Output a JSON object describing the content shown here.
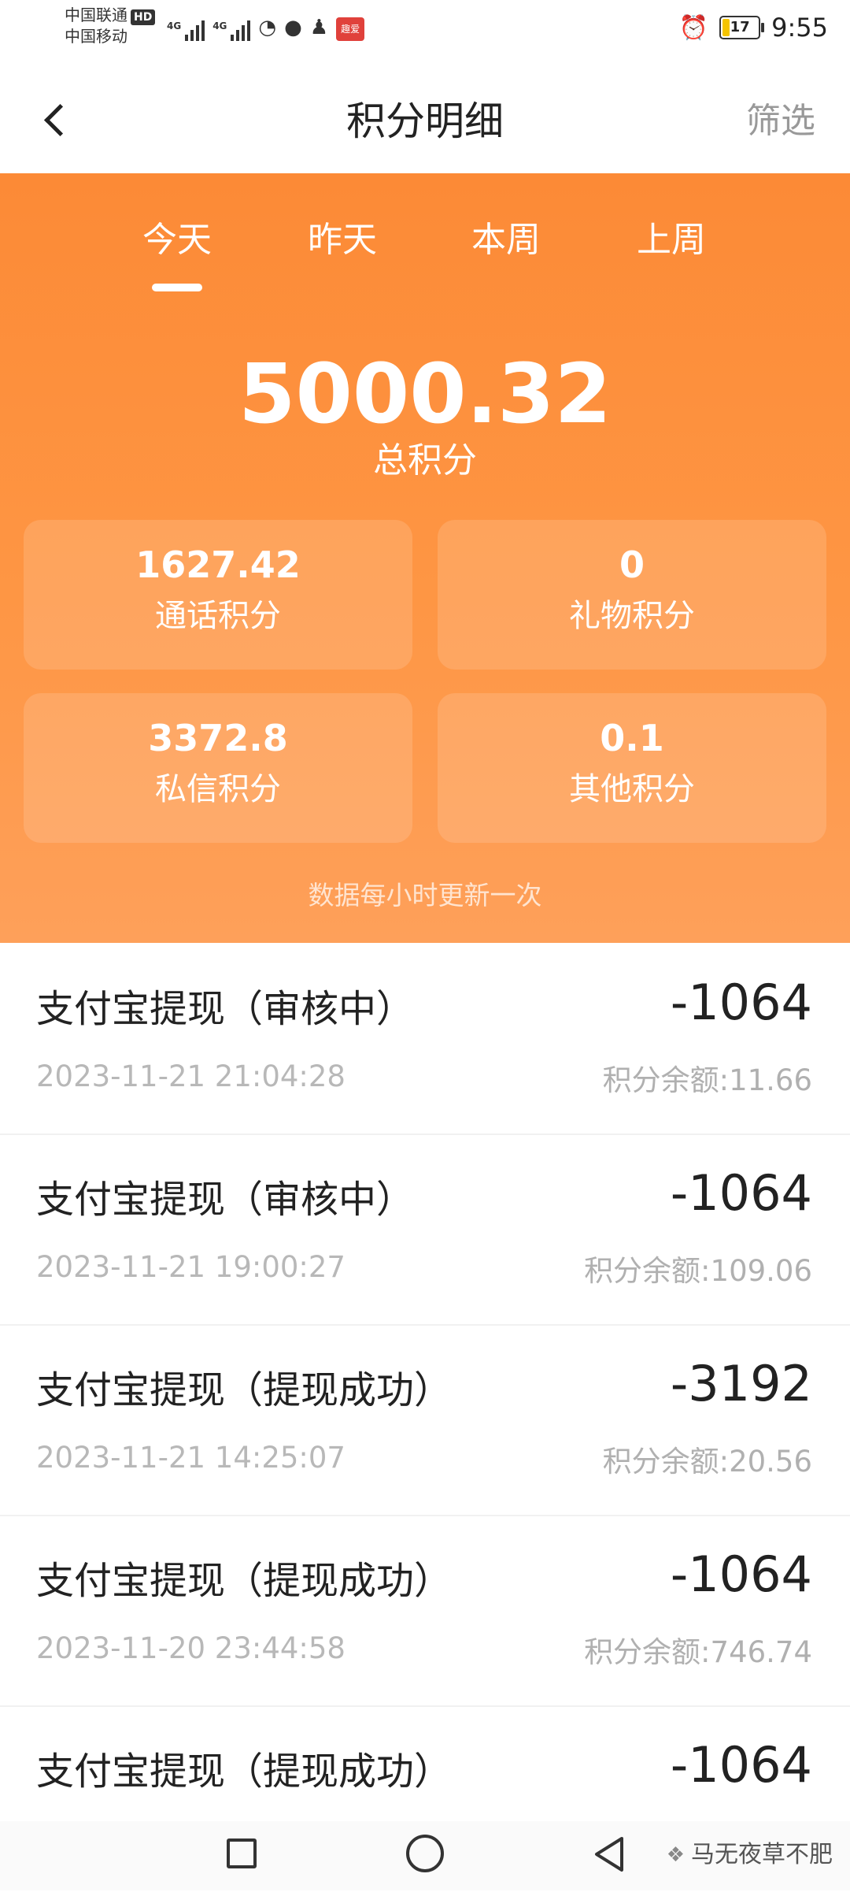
{
  "status_bar": {
    "carrier_1": "中国联通",
    "carrier_1_badge": "HD",
    "carrier_2": "中国移动",
    "net_label_1": "4G",
    "net_label_2": "4G",
    "battery": "17",
    "time": "9:55",
    "app_badge_text": "趣爱"
  },
  "nav": {
    "title": "积分明细",
    "filter_label": "筛选"
  },
  "tabs": [
    {
      "label": "今天",
      "selected": true
    },
    {
      "label": "昨天",
      "selected": false
    },
    {
      "label": "本周",
      "selected": false
    },
    {
      "label": "上周",
      "selected": false
    }
  ],
  "summary": {
    "total_value": "5000.32",
    "total_label": "总积分",
    "stats": [
      {
        "value": "1627.42",
        "label": "通话积分"
      },
      {
        "value": "0",
        "label": "礼物积分"
      },
      {
        "value": "3372.8",
        "label": "私信积分"
      },
      {
        "value": "0.1",
        "label": "其他积分"
      }
    ],
    "update_note": "数据每小时更新一次"
  },
  "records": [
    {
      "title": "支付宝提现（审核中）",
      "time": "2023-11-21 21:04:28",
      "amount": "-1064",
      "balance": "积分余额:11.66"
    },
    {
      "title": "支付宝提现（审核中）",
      "time": "2023-11-21 19:00:27",
      "amount": "-1064",
      "balance": "积分余额:109.06"
    },
    {
      "title": "支付宝提现（提现成功）",
      "time": "2023-11-21 14:25:07",
      "amount": "-3192",
      "balance": "积分余额:20.56"
    },
    {
      "title": "支付宝提现（提现成功）",
      "time": "2023-11-20 23:44:58",
      "amount": "-1064",
      "balance": "积分余额:746.74"
    },
    {
      "title": "支付宝提现（提现成功）",
      "time": "",
      "amount": "-1064",
      "balance": ""
    }
  ],
  "watermark": "马无夜草不肥",
  "colors": {
    "accent_orange": "#fc8a36",
    "text_dark": "#222222",
    "text_muted": "#b8b8b8"
  }
}
